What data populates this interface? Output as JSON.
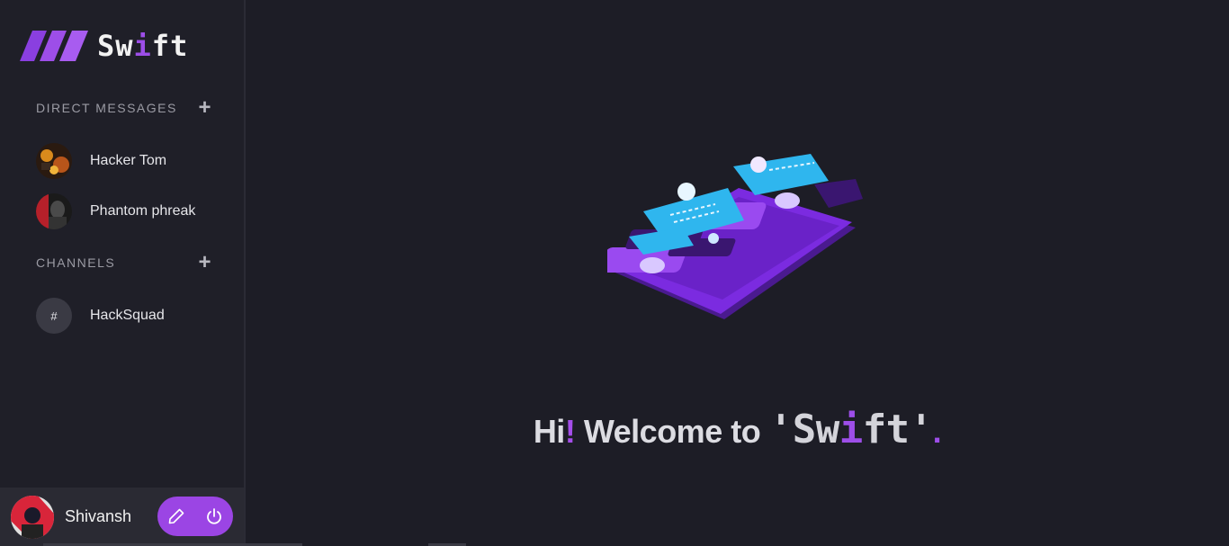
{
  "app": {
    "logo_name_prefix": "Sw",
    "logo_name_accent": "i",
    "logo_name_suffix": "ft"
  },
  "sidebar": {
    "direct_messages_header": "DIRECT MESSAGES",
    "channels_header": "CHANNELS",
    "direct_messages": [
      {
        "label": "Hacker Tom"
      },
      {
        "label": "Phantom phreak"
      }
    ],
    "channels": [
      {
        "label": "HackSquad",
        "symbol": "#"
      }
    ]
  },
  "user": {
    "name": "Shivansh"
  },
  "welcome": {
    "prefix": "Hi",
    "bang": "!",
    "middle": " Welcome to ",
    "quote_open": "'",
    "brand_prefix": "Sw",
    "brand_accent": "i",
    "brand_suffix": "ft",
    "quote_close": "'",
    "period": "."
  },
  "colors": {
    "accent": "#9d4ee8",
    "background": "#1d1d26",
    "sidebar": "#1f1f28"
  },
  "icons": {
    "logo": "stripes-logo-icon",
    "add": "plus-icon",
    "edit": "pencil-icon",
    "logout": "power-icon"
  }
}
